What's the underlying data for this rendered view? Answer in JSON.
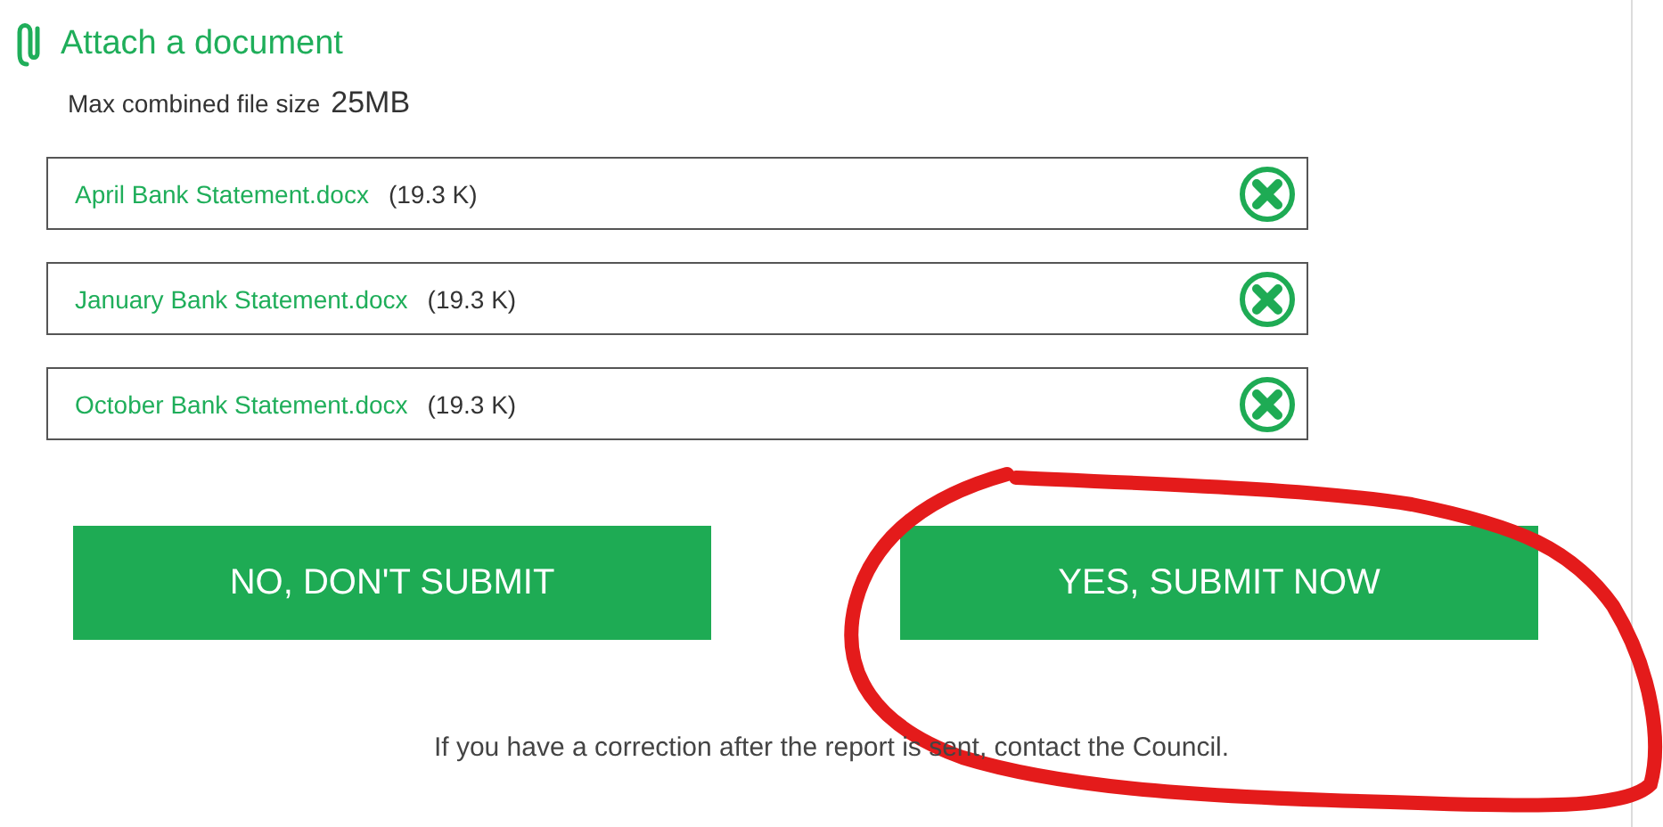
{
  "attach": {
    "title": "Attach a document",
    "limit_label": "Max combined file size",
    "limit_value": "25MB"
  },
  "files": [
    {
      "name": "April Bank Statement.docx",
      "size": "(19.3 K)"
    },
    {
      "name": "January Bank Statement.docx",
      "size": "(19.3 K)"
    },
    {
      "name": "October Bank Statement.docx",
      "size": "(19.3 K)"
    }
  ],
  "buttons": [
    "NO, DON'T SUBMIT",
    "YES, SUBMIT NOW"
  ],
  "note": "If you have a correction after the report is sent, contact the Council.",
  "annotation": {
    "kind": "circle"
  }
}
